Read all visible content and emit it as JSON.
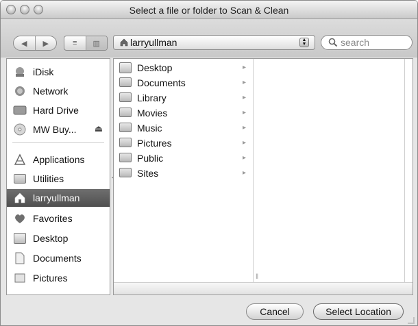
{
  "window": {
    "title": "Select a file or folder to Scan & Clean"
  },
  "toolbar": {
    "back_symbol": "◀",
    "forward_symbol": "▶",
    "view_list_symbol": "≡",
    "view_columns_symbol": "▥",
    "path_popup": {
      "label": "larryullman"
    },
    "search": {
      "placeholder": "search"
    }
  },
  "sidebar": {
    "devices": [
      {
        "label": "iDisk",
        "icon": "idisk-icon"
      },
      {
        "label": "Network",
        "icon": "network-icon"
      },
      {
        "label": "Hard Drive",
        "icon": "hard-drive-icon"
      },
      {
        "label": "MW Buy...",
        "icon": "disc-icon",
        "eject": "⏏"
      }
    ],
    "places": [
      {
        "label": "Applications",
        "icon": "applications-icon"
      },
      {
        "label": "Utilities",
        "icon": "folder-icon"
      },
      {
        "label": "larryullman",
        "icon": "home-icon",
        "selected": true
      },
      {
        "label": "Favorites",
        "icon": "heart-icon"
      },
      {
        "label": "Desktop",
        "icon": "desktop-icon"
      },
      {
        "label": "Documents",
        "icon": "documents-icon"
      },
      {
        "label": "Pictures",
        "icon": "pictures-icon"
      }
    ]
  },
  "browser": {
    "column1": [
      {
        "label": "Desktop",
        "icon": "desktop-icon"
      },
      {
        "label": "Documents",
        "icon": "folder-icon"
      },
      {
        "label": "Library",
        "icon": "library-icon"
      },
      {
        "label": "Movies",
        "icon": "movies-icon"
      },
      {
        "label": "Music",
        "icon": "music-icon"
      },
      {
        "label": "Pictures",
        "icon": "pictures-icon"
      },
      {
        "label": "Public",
        "icon": "public-icon"
      },
      {
        "label": "Sites",
        "icon": "sites-icon"
      }
    ],
    "chevron": "▸"
  },
  "buttons": {
    "cancel": "Cancel",
    "select_location": "Select Location"
  }
}
